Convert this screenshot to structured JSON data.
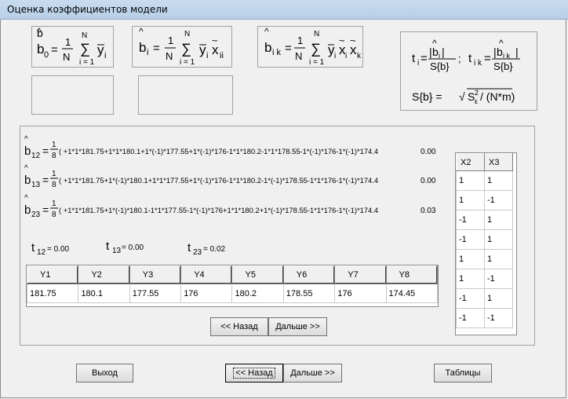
{
  "window": {
    "title": "Оценка коэффициентов модели"
  },
  "formulas": {
    "b0": {
      "lhs": "b",
      "sub": "0",
      "one": "1",
      "N": "N",
      "upper": "N",
      "lower": "i = 1",
      "y": "y",
      "ysub": "i"
    },
    "bi": {
      "lhs": "b",
      "sub": "i",
      "one": "1",
      "N": "N",
      "upper": "N",
      "lower": "i = 1",
      "y": "y",
      "ysub": "i",
      "x": "x",
      "xsub": "ii"
    },
    "bik": {
      "lhs": "b",
      "sub": "i k",
      "one": "1",
      "N": "N",
      "upper": "N",
      "lower": "i = 1",
      "y": "y",
      "ysub": "i",
      "x": "x",
      "xsub1": "i",
      "xsub2": "k"
    },
    "t": {
      "t": "t",
      "ti_sub": "i",
      "bi": "b",
      "bi_sub": "i",
      "Sb": "S{b}",
      "sep": ";",
      "tik_sub": "i k",
      "bik_sub": "i k"
    },
    "S": {
      "lhs": "S{b} = ",
      "S": "S",
      "sup": "2",
      "sub": "ε",
      "tail": "/ (N*m)"
    }
  },
  "coefficients": [
    {
      "name": "b",
      "sub": "12",
      "one": "1",
      "den": "8",
      "expr": "( +1*1*181.75+1*1*180.1+1*(-1)*177.55+1*(-1)*176-1*1*180.2-1*1*178.55-1*(-1)*176-1*(-1)*174.4",
      "value": "0.00"
    },
    {
      "name": "b",
      "sub": "13",
      "one": "1",
      "den": "8",
      "expr": "( +1*1*181.75+1*(-1)*180.1+1*1*177.55+1*(-1)*176-1*1*180.2-1*(-1)*178.55-1*1*176-1*(-1)*174.4",
      "value": "0.00"
    },
    {
      "name": "b",
      "sub": "23",
      "one": "1",
      "den": "8",
      "expr": "( +1*1*181.75+1*(-1)*180.1-1*1*177.55-1*(-1)*176+1*1*180.2+1*(-1)*178.55-1*1*176-1*(-1)*174.4",
      "value": "0.03"
    }
  ],
  "t_values": [
    {
      "t": "t",
      "sub": "12",
      "text": "= 0.00"
    },
    {
      "t": "t",
      "sub": "13",
      "text": "= 0.00"
    },
    {
      "t": "t",
      "sub": "23",
      "text": "= 0.02"
    }
  ],
  "y_table": {
    "headers": [
      "Y1",
      "Y2",
      "Y3",
      "Y4",
      "Y5",
      "Y6",
      "Y7",
      "Y8"
    ],
    "values": [
      "181.75",
      "180.1",
      "177.55",
      "176",
      "180.2",
      "178.55",
      "176",
      "174.45"
    ]
  },
  "x_table": {
    "headers": [
      "X2",
      "X3"
    ],
    "rows": [
      [
        "1",
        "1"
      ],
      [
        "1",
        "-1"
      ],
      [
        "-1",
        "1"
      ],
      [
        "-1",
        "1"
      ],
      [
        "1",
        "1"
      ],
      [
        "1",
        "-1"
      ],
      [
        "-1",
        "1"
      ],
      [
        "-1",
        "-1"
      ]
    ]
  },
  "inner_nav": {
    "back": "<< Назад",
    "next": "Дальше >>"
  },
  "footer": {
    "exit": "Выход",
    "back": "<< Назад",
    "next": "Дальше >>",
    "tables": "Таблицы"
  }
}
